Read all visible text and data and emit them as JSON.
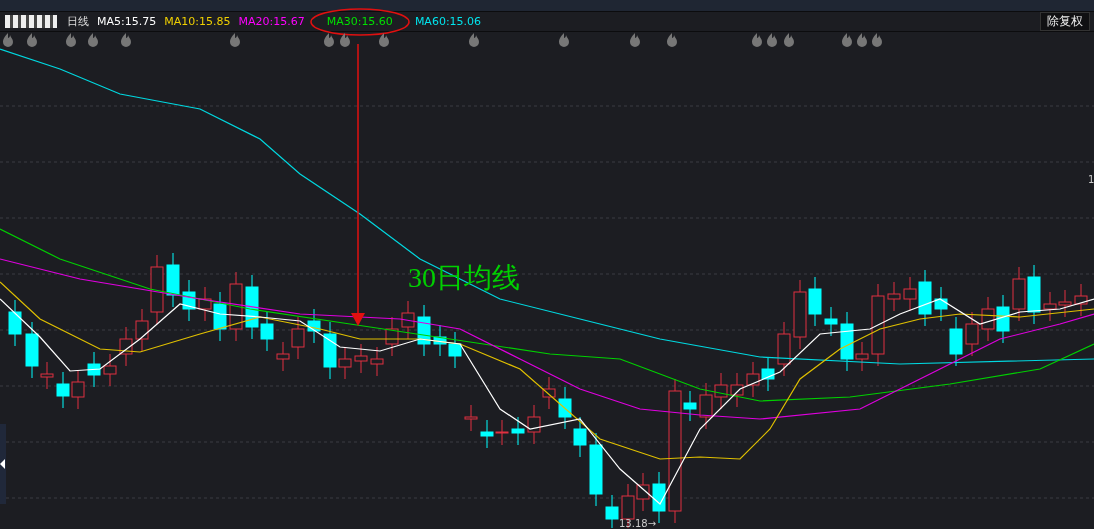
{
  "header": {
    "period": "日线",
    "ma_labels": [
      {
        "text": "MA5:15.75",
        "color": "#ffffff",
        "circled": false
      },
      {
        "text": "MA10:15.85",
        "color": "#f0d000",
        "circled": false
      },
      {
        "text": "MA20:15.67",
        "color": "#ff00ff",
        "circled": false
      },
      {
        "text": "MA30:15.60",
        "color": "#00e000",
        "circled": true
      },
      {
        "text": "MA60:15.06",
        "color": "#00e5ee",
        "circled": false
      }
    ],
    "button": "除复权"
  },
  "chart": {
    "annotation": "30日均线",
    "low_label": "13.18→",
    "edge_label": "1"
  }
}
